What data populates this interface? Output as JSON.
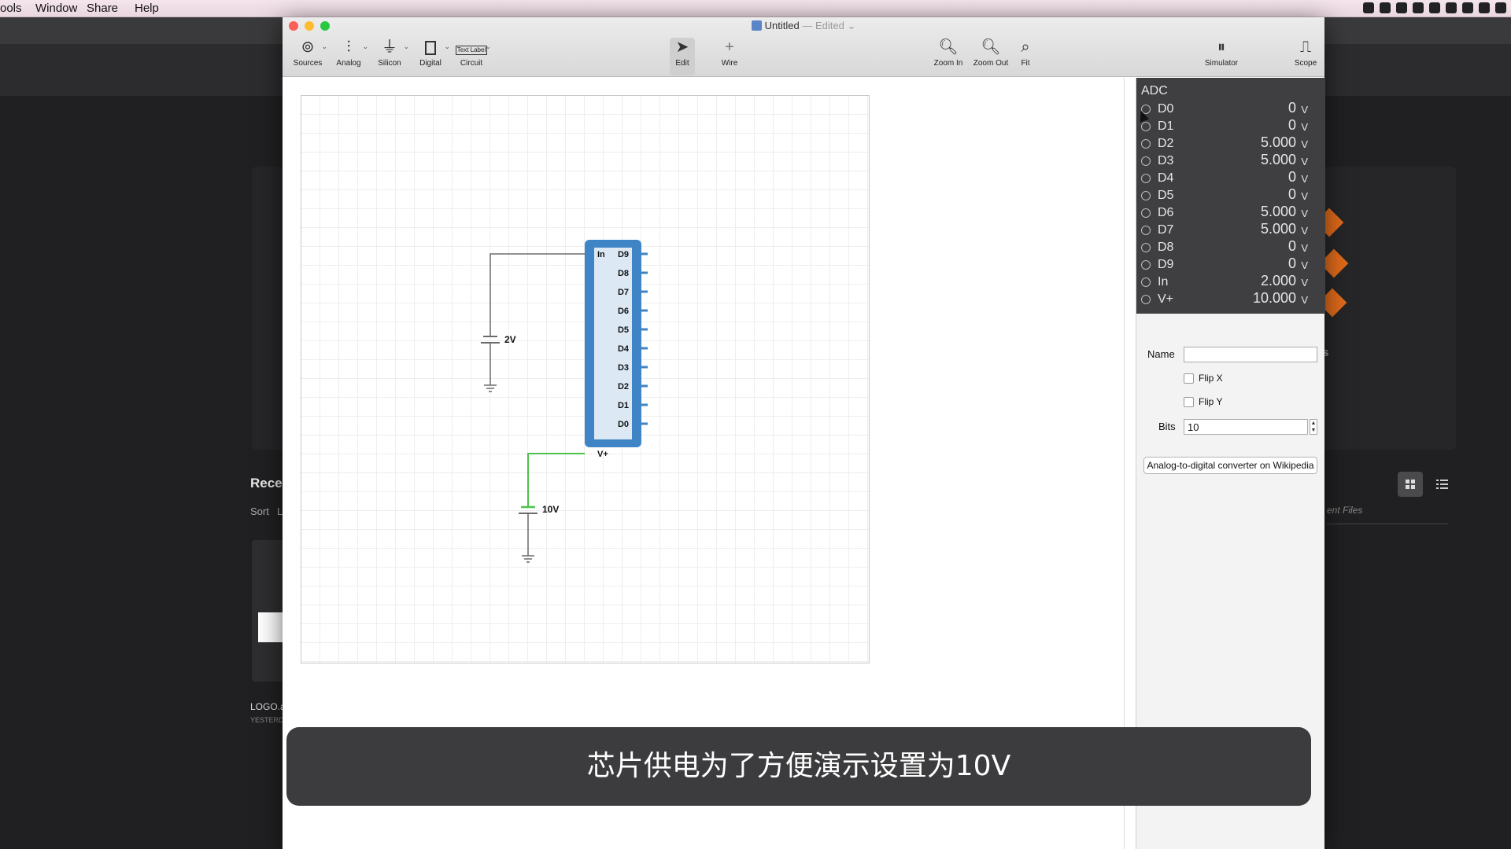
{
  "menubar": {
    "items": [
      "ools",
      "Window",
      "Share",
      "Help"
    ]
  },
  "background_app": {
    "recent_heading": "Recen",
    "sort_label": "Sort",
    "sort_suffix": "L",
    "file_name": "LOGO.a",
    "file_date": "YESTERD",
    "right_snippet": "s",
    "recent_files_label": "ent Files"
  },
  "window": {
    "title": "Untitled",
    "status": " — Edited",
    "toolbar": {
      "sources": "Sources",
      "analog": "Analog",
      "silicon": "Silicon",
      "digital": "Digital",
      "circuit": "Circuit",
      "text_label_icon": "Text Label",
      "edit": "Edit",
      "wire": "Wire",
      "zoom_in": "Zoom In",
      "zoom_out": "Zoom Out",
      "fit": "Fit",
      "simulator": "Simulator",
      "scope": "Scope"
    }
  },
  "circuit": {
    "battery_in_label": "2V",
    "battery_vplus_label": "10V",
    "adc_left_pins": [
      "In",
      "V+"
    ],
    "adc_right_pins": [
      "D9",
      "D8",
      "D7",
      "D6",
      "D5",
      "D4",
      "D3",
      "D2",
      "D1",
      "D0"
    ]
  },
  "inspector": {
    "component": "ADC",
    "unit": "V",
    "pins": [
      {
        "name": "D0",
        "value": "0"
      },
      {
        "name": "D1",
        "value": "0"
      },
      {
        "name": "D2",
        "value": "5.000"
      },
      {
        "name": "D3",
        "value": "5.000"
      },
      {
        "name": "D4",
        "value": "0"
      },
      {
        "name": "D5",
        "value": "0"
      },
      {
        "name": "D6",
        "value": "5.000"
      },
      {
        "name": "D7",
        "value": "5.000"
      },
      {
        "name": "D8",
        "value": "0"
      },
      {
        "name": "D9",
        "value": "0"
      },
      {
        "name": "In",
        "value": "2.000"
      },
      {
        "name": "V+",
        "value": "10.000"
      }
    ],
    "name_label": "Name",
    "name_value": "",
    "flip_x": "Flip X",
    "flip_y": "Flip Y",
    "bits_label": "Bits",
    "bits_value": "10",
    "wiki_button": "Analog-to-digital converter on Wikipedia"
  },
  "subtitle": "芯片供电为了方便演示设置为10V",
  "colors": {
    "adc_body": "#3f84c4",
    "wire_in": "#6b6b6b",
    "wire_vplus": "#4cc24c"
  }
}
